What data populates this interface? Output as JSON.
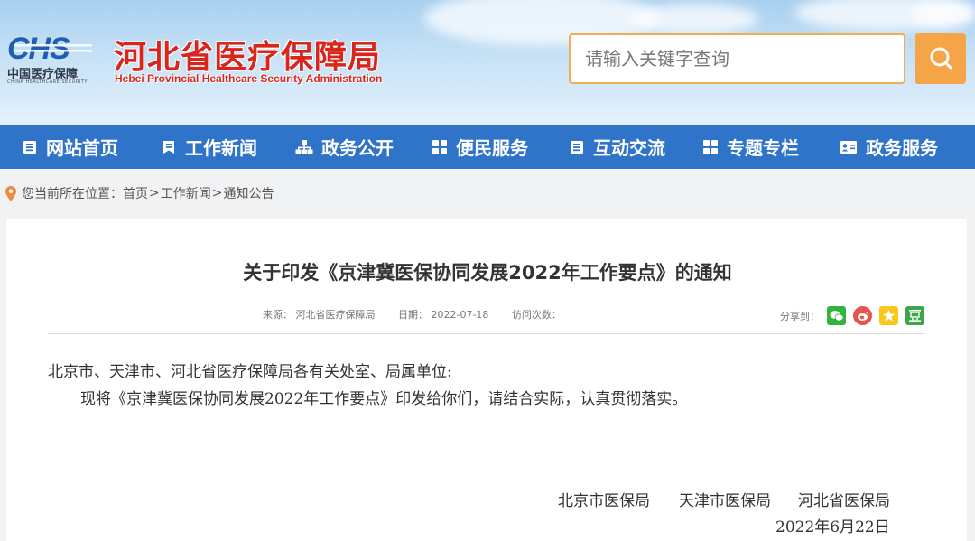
{
  "header": {
    "logo_mark": "CHS",
    "logo_cn": "中国医疗保障",
    "logo_en": "CHINA HEALTHCARE SECURITY",
    "site_title": "河北省医疗保障局",
    "site_subtitle": "Hebei Provincial Healthcare Security Administration",
    "search": {
      "placeholder": "请输入关键字查询",
      "button_icon": "search-icon"
    }
  },
  "nav": {
    "items": [
      {
        "label": "网站首页",
        "icon": "list-icon"
      },
      {
        "label": "工作新闻",
        "icon": "bookmark-icon"
      },
      {
        "label": "政务公开",
        "icon": "org-chart-icon"
      },
      {
        "label": "便民服务",
        "icon": "grid-icon"
      },
      {
        "label": "互动交流",
        "icon": "list-icon"
      },
      {
        "label": "专题专栏",
        "icon": "grid-icon"
      },
      {
        "label": "政务服务",
        "icon": "id-card-icon"
      }
    ]
  },
  "breadcrumb": {
    "prefix": "您当前所在位置：",
    "items": [
      "首页",
      "工作新闻",
      "通知公告"
    ],
    "separator": ">"
  },
  "article": {
    "title": "关于印发《京津冀医保协同发展2022年工作要点》的通知",
    "meta": {
      "source": "来源：  河北省医疗保障局",
      "date": "日期：  2022-07-18",
      "views": "访问次数："
    },
    "share_label": "分享到：",
    "share_icons": [
      "wechat-icon",
      "weibo-icon",
      "qzone-icon",
      "douban-icon"
    ],
    "paragraphs": [
      "北京市、天津市、河北省医疗保障局各有关处室、局属单位:",
      "现将《京津冀医保协同发展2022年工作要点》印发给你们，请结合实际，认真贯彻落实。"
    ],
    "signatories": [
      "北京市医保局",
      "天津市医保局",
      "河北省医保局"
    ],
    "sign_date": "2022年6月22日"
  },
  "colors": {
    "nav_bg": "#2f74c9",
    "title_red": "#d9261c",
    "search_orange": "#f5a447",
    "logo_blue": "#1f5fb3"
  }
}
